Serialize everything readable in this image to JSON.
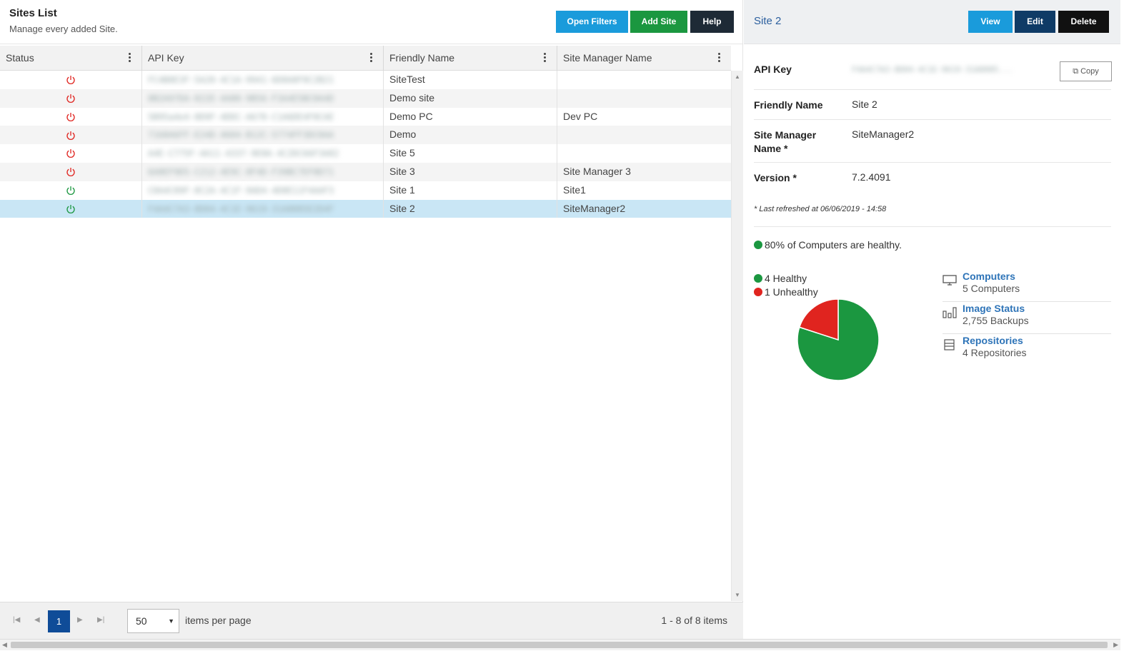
{
  "header": {
    "title": "Sites List",
    "subtitle": "Manage every added Site.",
    "open_filters": "Open Filters",
    "add_site": "Add Site",
    "help": "Help"
  },
  "table": {
    "columns": [
      "Status",
      "API Key",
      "Friendly Name",
      "Site Manager Name"
    ],
    "rows": [
      {
        "status": "offline",
        "name": "SiteTest",
        "manager": ""
      },
      {
        "status": "offline",
        "name": "Demo site",
        "manager": ""
      },
      {
        "status": "offline",
        "name": "Demo PC",
        "manager": "Dev PC"
      },
      {
        "status": "offline",
        "name": "Demo",
        "manager": ""
      },
      {
        "status": "offline",
        "name": "Site 5",
        "manager": ""
      },
      {
        "status": "offline",
        "name": "Site 3",
        "manager": "Site Manager 3"
      },
      {
        "status": "online",
        "name": "Site 1",
        "manager": "Site1"
      },
      {
        "status": "online",
        "name": "Site 2",
        "manager": "SiteManager2",
        "selected": true
      }
    ]
  },
  "pager": {
    "current_page": "1",
    "page_size": "50",
    "items_label": "items per page",
    "info": "1 - 8 of 8 items"
  },
  "detail": {
    "title": "Site 2",
    "view": "View",
    "edit": "Edit",
    "delete": "Delete",
    "api_key_label": "API Key",
    "copy": "Copy",
    "friendly_name_label": "Friendly Name",
    "friendly_name": "Site 2",
    "manager_label_1": "Site Manager",
    "manager_label_2": "Name *",
    "manager": "SiteManager2",
    "version_label": "Version *",
    "version": "7.2.4091",
    "refreshed": "* Last refreshed at 06/06/2019 - 14:58",
    "health_summary": "80% of Computers are healthy.",
    "legend_healthy": "4 Healthy",
    "legend_unhealthy": "1 Unhealthy",
    "stats": [
      {
        "link": "Computers",
        "sub": "5 Computers",
        "icon": "monitor-icon"
      },
      {
        "link": "Image Status",
        "sub": "2,755 Backups",
        "icon": "bar-chart-icon"
      },
      {
        "link": "Repositories",
        "sub": "4 Repositories",
        "icon": "repository-icon"
      }
    ]
  },
  "colors": {
    "healthy": "#1b9740",
    "unhealthy": "#e0241f",
    "offline_icon": "#e0241f",
    "online_icon": "#1b9740",
    "selected_row": "#c9e6f5"
  },
  "chart_data": {
    "type": "pie",
    "categories": [
      "Healthy",
      "Unhealthy"
    ],
    "values": [
      4,
      1
    ],
    "legend": "top-left"
  }
}
